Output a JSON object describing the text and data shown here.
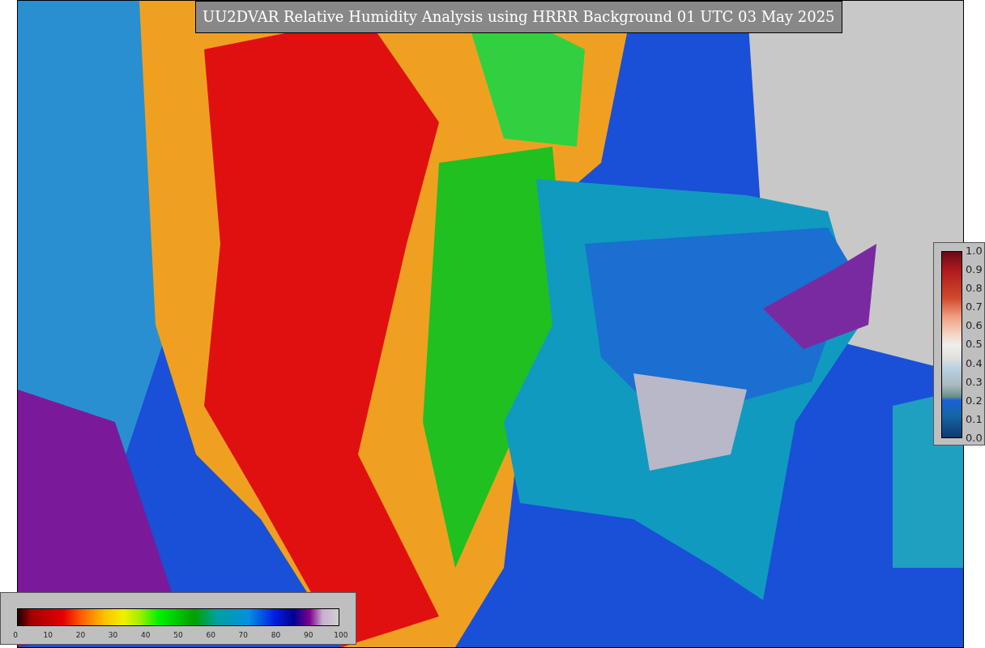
{
  "map": {
    "title": "UU2DVAR Relative Humidity Analysis using HRRR Background 01 UTC 03 May 2025"
  },
  "colorbars": [
    {
      "kind": "vertical",
      "ticks": [
        "1.0",
        "0.9",
        "0.8",
        "0.7",
        "0.6",
        "0.5",
        "0.4",
        "0.3",
        "0.2",
        "0.1",
        "0.0"
      ]
    },
    {
      "kind": "horizontal",
      "ticks": [
        "0",
        "10",
        "20",
        "30",
        "40",
        "50",
        "60",
        "70",
        "80",
        "90",
        "100"
      ]
    }
  ]
}
